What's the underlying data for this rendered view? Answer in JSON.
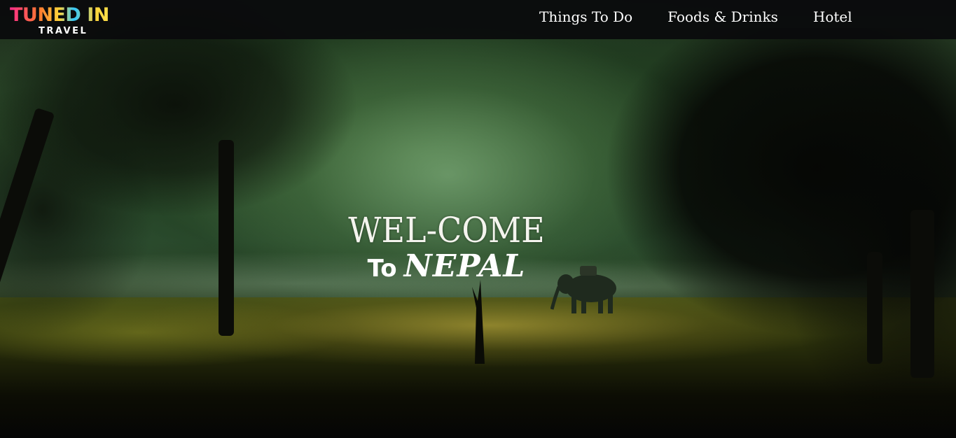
{
  "brand": {
    "name": "TUNED IN",
    "tagline": "TRAVEL"
  },
  "nav": {
    "items": [
      {
        "label": "Things To Do"
      },
      {
        "label": "Foods & Drinks"
      },
      {
        "label": "Hotel"
      }
    ]
  },
  "hero": {
    "headline": "WEL-COME",
    "to": "To",
    "place": "NEPAL",
    "background_scene": "misty-forest-with-elephant"
  },
  "colors": {
    "navbar": "#0a0a0c",
    "nav_text": "#ffffff",
    "logo_pink": "#ff2d8a",
    "logo_yellow": "#ffd43a",
    "logo_blue": "#2fc7ff"
  }
}
